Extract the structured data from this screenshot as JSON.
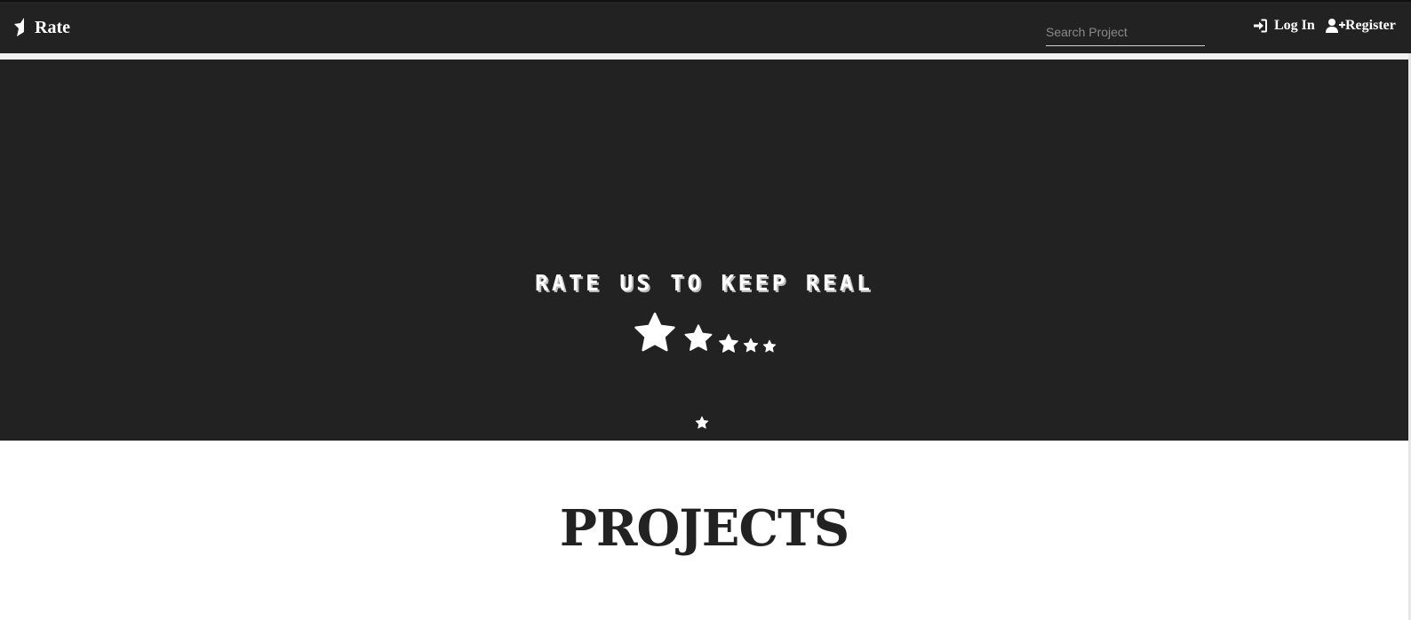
{
  "navbar": {
    "brand_label": "Rate",
    "brand_icon": "star-half-icon",
    "search_placeholder": "Search Project",
    "search_value": "",
    "login_label": "Log In",
    "login_icon": "sign-in-icon",
    "register_label": "Register",
    "register_icon": "user-plus-icon"
  },
  "hero": {
    "tagline": "RATE US TO KEEP REAL",
    "rating_icon": "star-icon",
    "scroll_icon": "star-icon"
  },
  "projects": {
    "heading": "PROJECTS"
  },
  "colors": {
    "navbar_bg": "#222222",
    "hero_bg": "#222222",
    "text_light": "#ffffff",
    "heading_dark": "#222222"
  }
}
